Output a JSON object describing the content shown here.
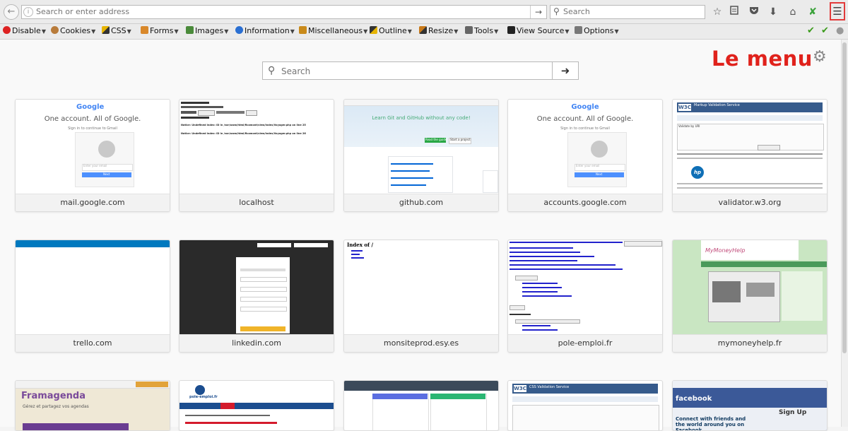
{
  "navbar": {
    "url_placeholder": "Search or enter address",
    "search_placeholder": "Search"
  },
  "devbar": {
    "items": [
      {
        "label": "Disable"
      },
      {
        "label": "Cookies"
      },
      {
        "label": "CSS"
      },
      {
        "label": "Forms"
      },
      {
        "label": "Images"
      },
      {
        "label": "Information"
      },
      {
        "label": "Miscellaneous"
      },
      {
        "label": "Outline"
      },
      {
        "label": "Resize"
      },
      {
        "label": "Tools"
      },
      {
        "label": "View Source"
      },
      {
        "label": "Options"
      }
    ]
  },
  "annotation": "Le menu",
  "content_search": {
    "placeholder": "Search"
  },
  "tiles": [
    {
      "label": "mail.google.com"
    },
    {
      "label": "localhost"
    },
    {
      "label": "github.com"
    },
    {
      "label": "accounts.google.com"
    },
    {
      "label": "validator.w3.org"
    },
    {
      "label": "trello.com"
    },
    {
      "label": "linkedin.com"
    },
    {
      "label": "monsiteprod.esy.es"
    },
    {
      "label": "pole-emploi.fr"
    },
    {
      "label": "mymoneyhelp.fr"
    }
  ],
  "thumbs": {
    "google_brand": "Google",
    "google_tagline": "One account. All of Google.",
    "google_signin": "Sign in to continue to Gmail",
    "google_email_placeholder": "Enter your email",
    "google_next": "Next",
    "localhost_line1": "Notice: Undefined index: ID in /var/www/html/ficamont/view/index/Voyager.php on line 25",
    "localhost_line2": "Notice: Undefined index: ID in /var/www/html/ficamont/view/index/Voyager.php on line 26",
    "github_title": "Learn Git and GitHub without any code!",
    "github_btn1": "Read the guide",
    "github_btn2": "Start a project",
    "w3c_title": "Markup Validation Service",
    "w3c_sub": "Validate by URI",
    "index_of": "Index of /",
    "framagenda": "Framagenda",
    "framagenda_tag": "Gérez et partagez vos agendas",
    "pole_title": "pole-emploi.fr",
    "mymoney": "MyMoneyHelp",
    "facebook": "facebook",
    "facebook_tag": "Connect with friends and the world around you on Facebook.",
    "facebook_signup": "Sign Up",
    "css_validation": "CSS Validation Service"
  }
}
